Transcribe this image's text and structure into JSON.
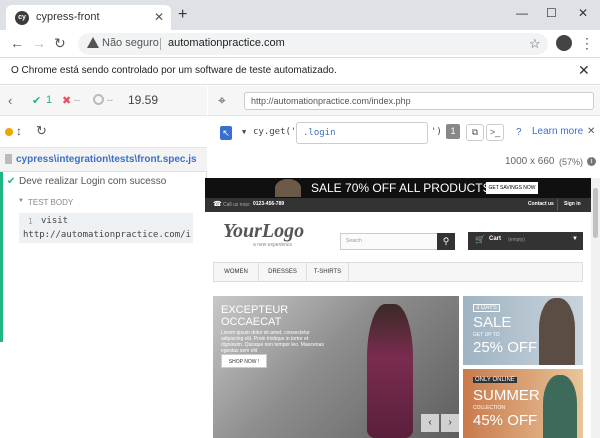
{
  "browser": {
    "tab_title": "cypress-front",
    "tab_favicon": "cy",
    "insecure_label": "Não seguro",
    "url": "automationpractice.com",
    "infobar_message": "O Chrome está sendo controlado por um software de teste automatizado."
  },
  "runner": {
    "passed": "1",
    "failed": "--",
    "pending": "--",
    "duration": "19.59",
    "spec_path": "cypress\\integration\\tests\\front.spec.js",
    "test_title": "Deve realizar Login com sucesso",
    "test_body_label": "TEST BODY",
    "command_number": "1",
    "command_name": "visit",
    "command_arg": "http://automationpractice.com/index…",
    "aut_url": "http://automationpractice.com/index.php",
    "selector_prefix": "cy.get('",
    "selector_value": ".login",
    "selector_suffix": "')",
    "selector_count": "1",
    "learn_more": "Learn more",
    "viewport_size": "1000 x 660",
    "viewport_scale": "(57%)"
  },
  "site": {
    "banner": "SALE 70% OFF ALL PRODUCTS",
    "banner_button": "GET SAVINGS NOW",
    "call_label": "Call us now:",
    "phone": "0123-456-789",
    "contact": "Contact us",
    "signin": "Sign in",
    "logo": "YourLogo",
    "logo_tagline": "a new experience",
    "search_placeholder": "Search",
    "cart_label": "Cart",
    "cart_empty": "(empty)",
    "menu": [
      "WOMEN",
      "DRESSES",
      "T-SHIRTS"
    ],
    "slide_title_1": "EXCEPTEUR",
    "slide_title_2": "OCCAECAT",
    "slide_text": "Lorem ipsum dolor sit amet, consectetur adipiscing elit. Proin tristique in tortor et dignissim. Quisque non tempor leo. Maecenas egestas sem elit",
    "slide_button": "SHOP NOW !",
    "promo1_tag": "3 DAYS",
    "promo1_title": "SALE",
    "promo1_sub": "GET UP TO",
    "promo1_off": "25% OFF",
    "promo2_tag": "ONLY ONLINE",
    "promo2_title": "SUMMER",
    "promo2_sub": "COLLECTION",
    "promo2_off": "45% OFF"
  },
  "colors": {
    "cypress_green": "#1fb681",
    "cypress_red": "#e94f5f",
    "link_blue": "#3b6fcf"
  }
}
